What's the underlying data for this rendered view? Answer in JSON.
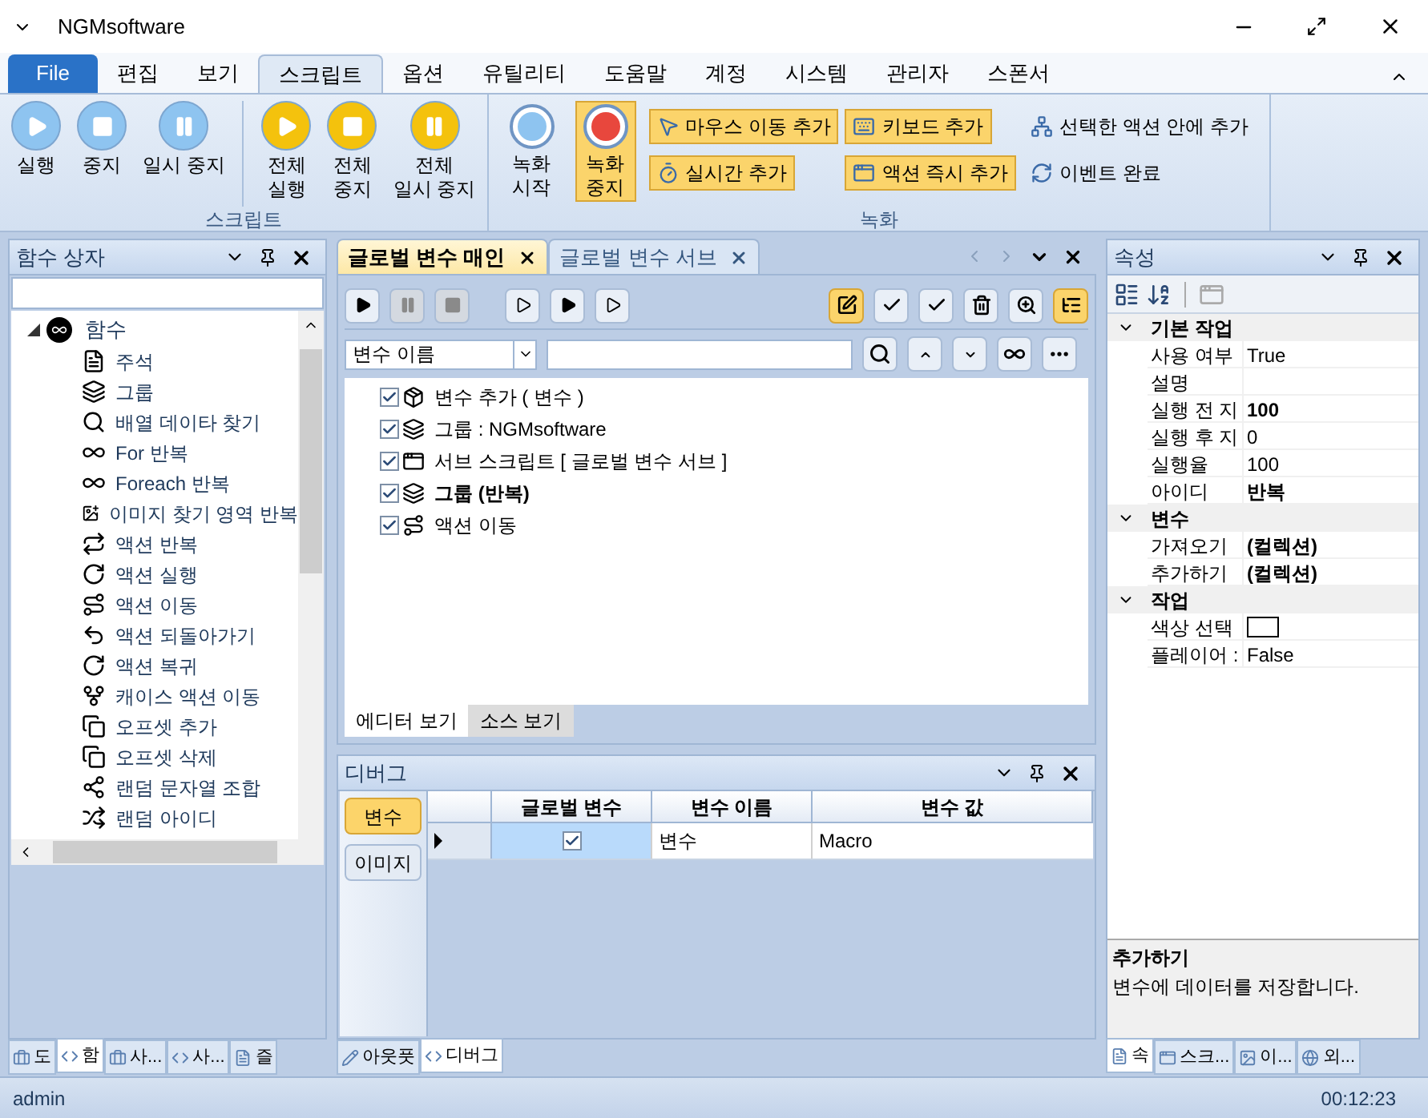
{
  "window": {
    "title": "NGMsoftware"
  },
  "ribbon_tabs": [
    {
      "label": "File",
      "kind": "file",
      "selected": false
    },
    {
      "label": "편집",
      "kind": "tab",
      "selected": false
    },
    {
      "label": "보기",
      "kind": "tab",
      "selected": false
    },
    {
      "label": "스크립트",
      "kind": "tab",
      "selected": true
    },
    {
      "label": "옵션",
      "kind": "tab",
      "selected": false
    },
    {
      "label": "유틸리티",
      "kind": "tab",
      "selected": false
    },
    {
      "label": "도움말",
      "kind": "tab",
      "selected": false
    },
    {
      "label": "계정",
      "kind": "tab",
      "selected": false
    },
    {
      "label": "시스템",
      "kind": "tab",
      "selected": false
    },
    {
      "label": "관리자",
      "kind": "tab",
      "selected": false
    },
    {
      "label": "스폰서",
      "kind": "tab",
      "selected": false
    }
  ],
  "script_group": {
    "label": "스크립트",
    "buttons": [
      {
        "label": "실행",
        "kind": "play",
        "color": "#8ec4f0"
      },
      {
        "label": "중지",
        "kind": "stop",
        "color": "#8ec4f0"
      },
      {
        "label": "일시 중지",
        "kind": "pause",
        "color": "#8ec4f0"
      },
      {
        "label": "전체\n실행",
        "kind": "play",
        "color": "#f4c20d"
      },
      {
        "label": "전체\n중지",
        "kind": "stop",
        "color": "#f4c20d"
      },
      {
        "label": "전체\n일시 중지",
        "kind": "pause",
        "color": "#f4c20d"
      }
    ]
  },
  "record_group": {
    "label": "녹화",
    "big_buttons": [
      {
        "label": "녹화\n시작",
        "kind": "start",
        "selected": false
      },
      {
        "label": "녹화\n중지",
        "kind": "stop",
        "selected": true
      }
    ],
    "small_buttons": [
      {
        "label": "마우스 이동 추가",
        "kind": "mouse",
        "highlighted": true
      },
      {
        "label": "키보드 추가",
        "kind": "keyboard",
        "highlighted": true
      },
      {
        "label": "선택한 액션 안에 추가",
        "kind": "tree",
        "highlighted": false
      },
      {
        "label": "실시간 추가",
        "kind": "timer",
        "highlighted": true
      },
      {
        "label": "액션 즉시 추가",
        "kind": "window",
        "highlighted": true
      },
      {
        "label": "이벤트 완료",
        "kind": "refresh",
        "highlighted": false
      }
    ]
  },
  "function_box": {
    "title": "함수 상자",
    "root": {
      "label": "함수",
      "expanded": true,
      "children": [
        {
          "label": "주석"
        },
        {
          "label": "그룹"
        },
        {
          "label": "배열 데이타 찾기"
        },
        {
          "label": "For 반복"
        },
        {
          "label": "Foreach 반복"
        },
        {
          "label": "이미지 찾기 영역 반복"
        },
        {
          "label": "액션 반복"
        },
        {
          "label": "액션 실행"
        },
        {
          "label": "액션 이동"
        },
        {
          "label": "액션 되돌아가기"
        },
        {
          "label": "액션 복귀"
        },
        {
          "label": "캐이스 액션 이동"
        },
        {
          "label": "오프셋 추가"
        },
        {
          "label": "오프셋 삭제"
        },
        {
          "label": "랜덤 문자열 조합"
        },
        {
          "label": "랜덤 아이디"
        }
      ]
    },
    "bottom_tabs": [
      {
        "label": "도",
        "selected": false
      },
      {
        "label": "함",
        "selected": true
      },
      {
        "label": "사...",
        "selected": false
      },
      {
        "label": "사...",
        "selected": false
      },
      {
        "label": "즐",
        "selected": false
      }
    ]
  },
  "editor": {
    "tabs": [
      {
        "label": "글로벌 변수 매인",
        "selected": true
      },
      {
        "label": "글로벌 변수 서브",
        "selected": false
      }
    ],
    "toolbar_left": [
      {
        "disabled": false
      },
      {
        "disabled": true
      },
      {
        "disabled": true
      },
      {
        "disabled": false
      },
      {
        "disabled": false
      },
      {
        "disabled": false
      }
    ],
    "toolbar_right": [
      {
        "highlighted": true
      },
      {
        "highlighted": false
      },
      {
        "highlighted": false
      },
      {
        "highlighted": false
      },
      {
        "highlighted": false
      },
      {
        "highlighted": true
      }
    ],
    "filter": {
      "value": "변수 이름"
    },
    "items": [
      {
        "label": "변수 추가 ( 변수 )",
        "checked": true,
        "bold": false
      },
      {
        "label": "그룹 : NGMsoftware",
        "checked": true,
        "bold": false
      },
      {
        "label": "서브 스크립트 [ 글로벌 변수 서브 ]",
        "checked": true,
        "bold": false
      },
      {
        "label": "그룹 (반복)",
        "checked": true,
        "bold": true
      },
      {
        "label": "액션 이동",
        "checked": true,
        "bold": false
      }
    ],
    "view_tabs": [
      {
        "label": "에디터 보기",
        "selected": true
      },
      {
        "label": "소스 보기",
        "selected": false
      }
    ]
  },
  "debug": {
    "title": "디버그",
    "side_buttons": [
      {
        "label": "변수",
        "selected": true
      },
      {
        "label": "이미지",
        "selected": false
      }
    ],
    "columns": [
      "글로벌 변수",
      "변수 이름",
      "변수 값"
    ],
    "rows": [
      {
        "global": true,
        "name": "변수",
        "value": "Macro",
        "current": true
      }
    ],
    "bottom_tabs": [
      {
        "label": "아웃풋",
        "selected": false
      },
      {
        "label": "디버그",
        "selected": true
      }
    ]
  },
  "properties": {
    "title": "속성",
    "categories": [
      {
        "label": "기본 작업",
        "expanded": true,
        "props": [
          {
            "name": "사용 여부",
            "value": "True"
          },
          {
            "name": "설명"
          },
          {
            "name": "실행 전 지",
            "value": "100",
            "bold": true
          },
          {
            "name": "실행 후 지",
            "value": "0"
          },
          {
            "name": "실행율",
            "value": "100"
          },
          {
            "name": "아이디",
            "value": "반복",
            "bold": true
          }
        ]
      },
      {
        "label": "변수",
        "expanded": true,
        "props": [
          {
            "name": "가져오기",
            "value": "(컬렉션)",
            "bold": true
          },
          {
            "name": "추가하기",
            "value": "(컬렉션)",
            "bold": true
          }
        ]
      },
      {
        "label": "작업",
        "expanded": true,
        "props": [
          {
            "name": "색상 선택",
            "kind": "color",
            "color": "#ffffff"
          },
          {
            "name": "플레이어 :",
            "value": "False"
          }
        ]
      }
    ],
    "description": {
      "title": "추가하기",
      "text": "변수에 데이터를 저장합니다."
    },
    "bottom_tabs": [
      {
        "label": "속",
        "selected": true
      },
      {
        "label": "스크...",
        "selected": false
      },
      {
        "label": "이...",
        "selected": false
      },
      {
        "label": "외...",
        "selected": false
      }
    ]
  },
  "status_bar": {
    "user": "admin",
    "time": "00:12:23"
  }
}
